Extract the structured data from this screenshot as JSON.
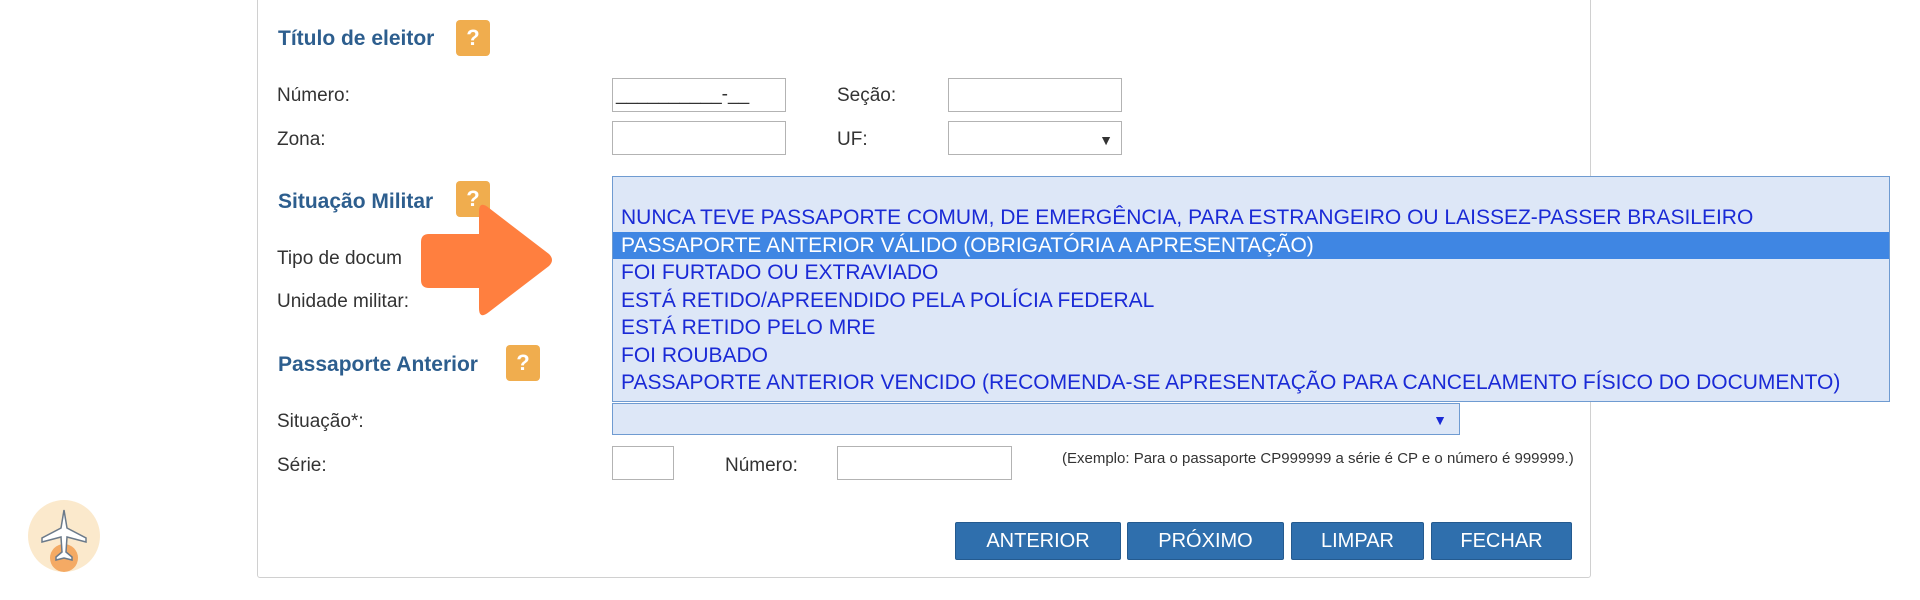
{
  "sections": {
    "titulo_eleitor": {
      "title": "Título de eleitor",
      "help": "?"
    },
    "situacao_militar": {
      "title": "Situação Militar",
      "help": "?"
    },
    "passaporte_anterior": {
      "title": "Passaporte Anterior",
      "help": "?"
    }
  },
  "titulo_fields": {
    "numero_label": "Número:",
    "numero_value": "__________-__",
    "secao_label": "Seção:",
    "zona_label": "Zona:",
    "uf_label": "UF:"
  },
  "militar_fields": {
    "tipo_label": "Tipo de docum",
    "unidade_label": "Unidade militar:"
  },
  "passaporte_fields": {
    "situacao_label": "Situação*:",
    "serie_label": "Série:",
    "numero_label": "Número:",
    "hint": "(Exemplo: Para o passaporte CP999999 a série é CP e o número é 999999.)"
  },
  "dropdown": {
    "options": [
      "",
      "NUNCA TEVE PASSAPORTE COMUM, DE EMERGÊNCIA, PARA ESTRANGEIRO OU LAISSEZ-PASSER BRASILEIRO",
      "PASSAPORTE ANTERIOR VÁLIDO (OBRIGATÓRIA A APRESENTAÇÃO)",
      "FOI FURTADO OU EXTRAVIADO",
      "ESTÁ RETIDO/APREENDIDO PELA POLÍCIA FEDERAL",
      "ESTÁ RETIDO PELO MRE",
      "FOI ROUBADO",
      "PASSAPORTE ANTERIOR VENCIDO (RECOMENDA-SE APRESENTAÇÃO PARA CANCELAMENTO FÍSICO DO DOCUMENTO)"
    ],
    "highlighted_index": 2
  },
  "buttons": {
    "anterior": "ANTERIOR",
    "proximo": "PRÓXIMO",
    "limpar": "LIMPAR",
    "fechar": "FECHAR"
  },
  "icons": {
    "arrow": "arrow-right-icon",
    "avatar": "airplane-icon",
    "caret": "▼"
  },
  "colors": {
    "title": "#2d5e8e",
    "help": "#f0ad4e",
    "button": "#2f6fad",
    "dropdown_bg": "#dde7f7",
    "highlight": "#3f86e3",
    "option_text": "#1a2ad6",
    "arrow": "#ff7f3f"
  }
}
